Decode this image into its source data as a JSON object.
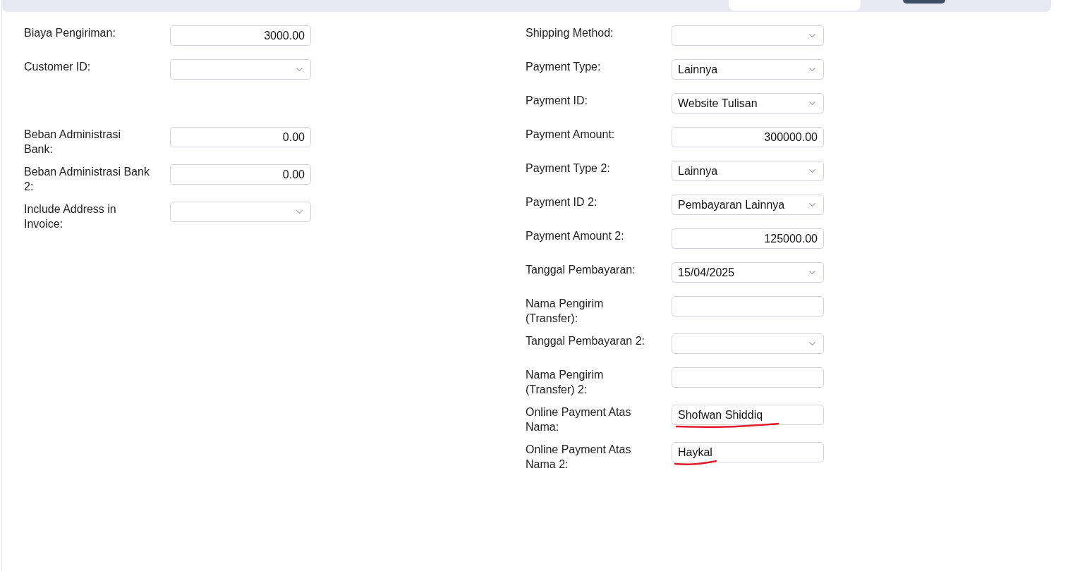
{
  "left_fields": [
    {
      "label": "Biaya Pengiriman:",
      "kind": "number",
      "value": "3000.00"
    },
    {
      "label": "Customer ID:",
      "kind": "select"
    },
    {
      "label": "Beban Administrasi Bank:",
      "kind": "number",
      "value": "0.00"
    },
    {
      "label": "Beban Administrasi Bank 2:",
      "kind": "number",
      "value": "0.00"
    },
    {
      "label": "Include Address in Invoice:",
      "kind": "select"
    }
  ],
  "right_fields": [
    {
      "label": "Shipping Method:",
      "kind": "select",
      "underlined": false
    },
    {
      "label": "Payment Type:",
      "kind": "select",
      "value": "Lainnya",
      "underlined": false
    },
    {
      "label": "Payment ID:",
      "kind": "select",
      "value": "Website Tulisan",
      "underlined": false
    },
    {
      "label": "Payment Amount:",
      "kind": "number",
      "value": "300000.00",
      "underlined": false
    },
    {
      "label": "Payment Type 2:",
      "kind": "select",
      "value": "Lainnya",
      "underlined": false
    },
    {
      "label": "Payment ID 2:",
      "kind": "select",
      "value": "Pembayaran Lainnya",
      "underlined": false
    },
    {
      "label": "Payment Amount 2:",
      "kind": "number",
      "value": "125000.00",
      "underlined": false
    },
    {
      "label": "Tanggal Pembayaran:",
      "kind": "select",
      "value": "15/04/2025",
      "underlined": false
    },
    {
      "label": "Nama Pengirim (Transfer):",
      "kind": "text",
      "underlined": false
    },
    {
      "label": "Tanggal Pembayaran 2:",
      "kind": "select",
      "underlined": false
    },
    {
      "label": "Nama Pengirim (Transfer) 2:",
      "kind": "text",
      "underlined": false
    },
    {
      "label": "Online Payment Atas Nama:",
      "kind": "text",
      "value": "Shofwan Shiddiq",
      "underlined": true
    },
    {
      "label": "Online Payment Atas Nama 2:",
      "kind": "text",
      "value": "Haykal",
      "underlined": true
    }
  ]
}
